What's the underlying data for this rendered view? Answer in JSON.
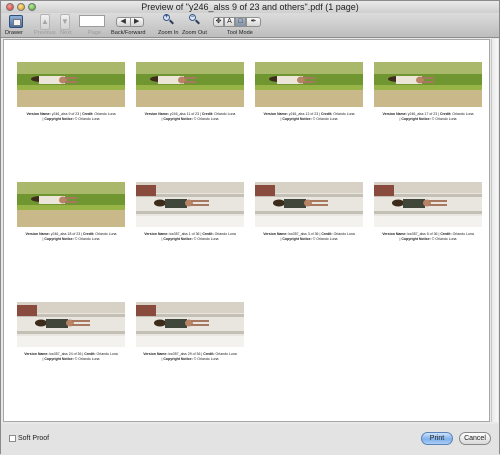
{
  "window": {
    "title": "Preview of \"y246_alss 9 of 23 and others\".pdf (1 page)"
  },
  "toolbar": {
    "drawer": "Drawer",
    "previous": "Previous",
    "next": "Next",
    "page": "Page",
    "back_forward": "Back/Forward",
    "back_glyph": "◀",
    "forward_glyph": "▶",
    "zoom_in": "Zoom In",
    "zoom_out": "Zoom Out",
    "tool_mode": "Tool Mode",
    "tool_glyphs": [
      "✥",
      "A",
      "□",
      "✒"
    ]
  },
  "thumbnails": [
    {
      "version": "y246_alss 9 of 23",
      "credit": "Orlando Luna",
      "notice": "© Orlando Luna",
      "scene": "beach"
    },
    {
      "version": "y246_alss 11 of 23",
      "credit": "Orlando Luna",
      "notice": "© Orlando Luna",
      "scene": "beach"
    },
    {
      "version": "y246_alss 12 of 23",
      "credit": "Orlando Luna",
      "notice": "© Orlando Luna",
      "scene": "beach"
    },
    {
      "version": "y246_alss 17 of 23",
      "credit": "Orlando Luna",
      "notice": "© Orlando Luna",
      "scene": "beach"
    },
    {
      "version": "y246_alss 18 of 23",
      "credit": "Orlando Luna",
      "notice": "© Orlando Luna",
      "scene": "beach"
    },
    {
      "version": "kw357_alss 1 of 36",
      "credit": "Orlando Luna",
      "notice": "© Orlando Luna",
      "scene": "porch"
    },
    {
      "version": "kw357_alss 3 of 36",
      "credit": "Orlando Luna",
      "notice": "© Orlando Luna",
      "scene": "porch"
    },
    {
      "version": "kw357_alss 5 of 36",
      "credit": "Orlando Luna",
      "notice": "© Orlando Luna",
      "scene": "porch"
    },
    {
      "version": "kw357_alss 24 of 36",
      "credit": "Orlando Luna",
      "notice": "© Orlando Luna",
      "scene": "porch"
    },
    {
      "version": "kw357_alss 29 of 36",
      "credit": "Orlando Luna",
      "notice": "© Orlando Luna",
      "scene": "porch"
    }
  ],
  "caption_labels": {
    "version": "Version Name:",
    "credit": "Credit:",
    "notice": "Copyright Notice:"
  },
  "bottom": {
    "soft_proof": "Soft Proof",
    "print": "Print",
    "cancel": "Cancel"
  },
  "colors": {
    "print_button": "#7fb1ea",
    "beach_grass": "#7a9f2c",
    "porch_floor": "#d7d2c5"
  }
}
